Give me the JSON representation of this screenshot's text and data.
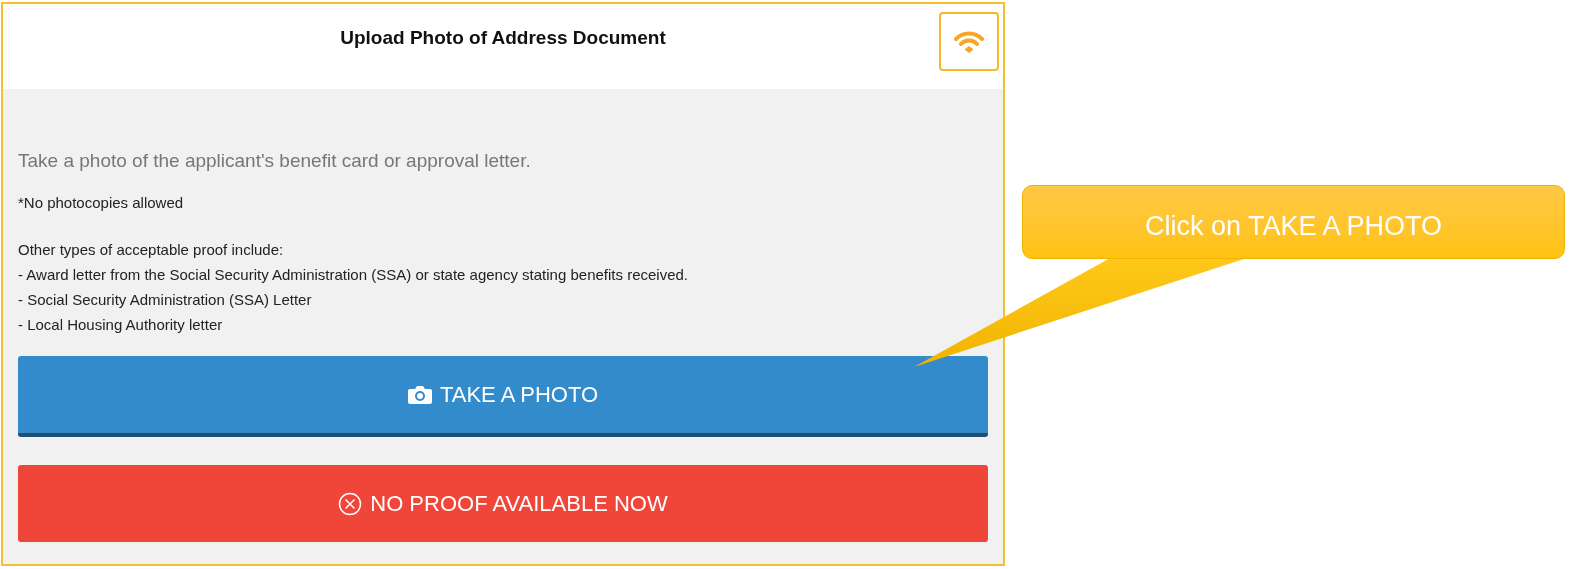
{
  "header": {
    "title": "Upload Photo of Address Document"
  },
  "instruction": "Take a photo of the applicant's benefit card or approval letter.",
  "note": "*No photocopies allowed",
  "proof_intro": "Other types of acceptable proof include:",
  "proof_items": [
    "- Award letter from the Social Security Administration (SSA) or state agency stating benefits received.",
    "- Social Security Administration (SSA) Letter",
    "- Local Housing Authority letter"
  ],
  "buttons": [
    {
      "label": "TAKE A PHOTO",
      "kind": "photo"
    },
    {
      "label": "NO PROOF AVAILABLE NOW",
      "kind": "skip"
    }
  ],
  "callout": {
    "text": "Click on TAKE A PHOTO"
  }
}
